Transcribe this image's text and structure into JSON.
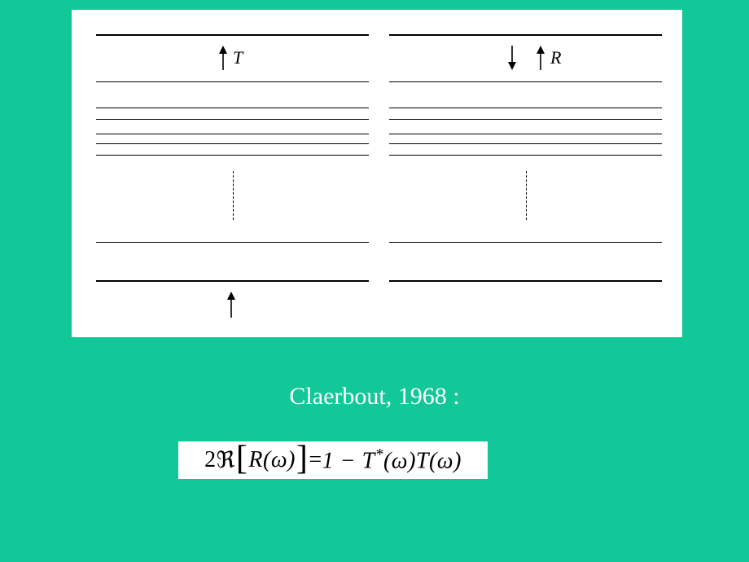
{
  "figure": {
    "left_panel_label": "T",
    "right_panel_label": "R"
  },
  "citation": "Claerbout, 1968 :",
  "equation": {
    "lhs_coeff": "2",
    "realpart_symbol": "ℜ",
    "inner": "R(ω)",
    "equals": " = ",
    "rhs_a": "1 − T",
    "rhs_b": "(ω)T(ω)",
    "superscript": "*"
  }
}
